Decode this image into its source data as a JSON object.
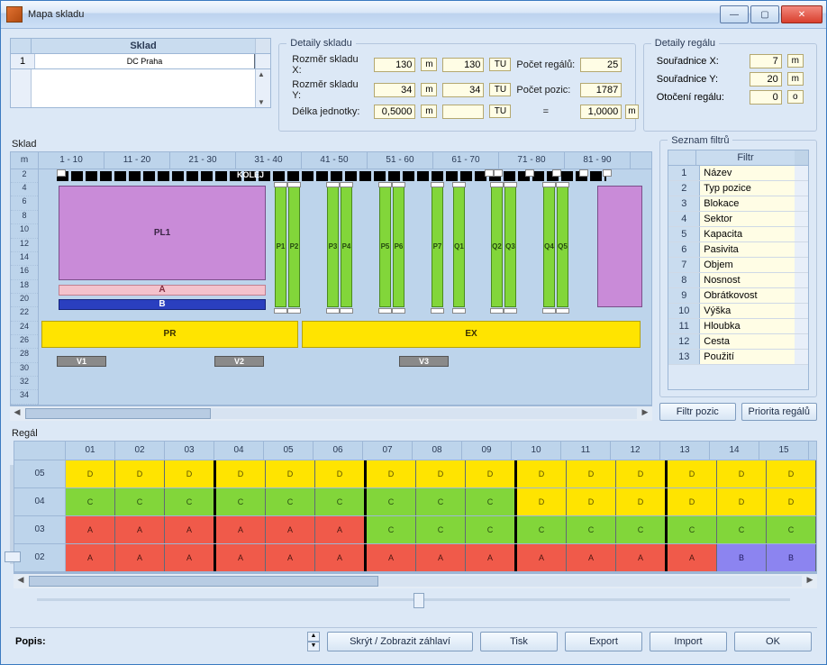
{
  "window": {
    "title": "Mapa skladu"
  },
  "sklad_picker": {
    "header": "Sklad",
    "rows": [
      {
        "num": "1",
        "name": "DC Praha"
      }
    ]
  },
  "details_sklad": {
    "legend": "Detaily skladu",
    "rows": [
      {
        "label": "Rozměr skladu X:",
        "v1": "130",
        "u1": "m",
        "v2": "130",
        "u2": "TU",
        "label2": "Počet regálů:",
        "v3": "25"
      },
      {
        "label": "Rozměr skladu Y:",
        "v1": "34",
        "u1": "m",
        "v2": "34",
        "u2": "TU",
        "label2": "Počet pozic:",
        "v3": "1787"
      },
      {
        "label": "Délka jednotky:",
        "v1": "0,5000",
        "u1": "m",
        "v2": "",
        "u2": "TU",
        "label2": "=",
        "v3": "1,0000",
        "u3": "m"
      }
    ]
  },
  "details_regal": {
    "legend": "Detaily regálu",
    "rows": [
      {
        "label": "Souřadnice X:",
        "v": "7",
        "u": "m"
      },
      {
        "label": "Souřadnice Y:",
        "v": "20",
        "u": "m"
      },
      {
        "label": "Otočení regálu:",
        "v": "0",
        "u": "o"
      }
    ]
  },
  "map": {
    "label": "Sklad",
    "cols": [
      "m",
      "1 - 10",
      "11 - 20",
      "21 - 30",
      "31 - 40",
      "41 - 50",
      "51 - 60",
      "61 - 70",
      "71 - 80",
      "81 - 90"
    ],
    "rows": [
      "2",
      "4",
      "6",
      "8",
      "10",
      "12",
      "14",
      "16",
      "18",
      "20",
      "22",
      "24",
      "26",
      "28",
      "30",
      "32",
      "34"
    ],
    "kolej": "KOLEJ",
    "pl": "PL1",
    "a": "A",
    "b": "B",
    "pr": "PR",
    "ex": "EX",
    "racks": [
      "P1",
      "P2",
      "P3",
      "P4",
      "P5",
      "P6",
      "P7",
      "Q1",
      "Q2",
      "Q3",
      "Q4",
      "Q5"
    ],
    "v": [
      "V1",
      "V2",
      "V3"
    ]
  },
  "filters": {
    "legend": "Seznam filtrů",
    "header": "Filtr",
    "items": [
      {
        "n": "1",
        "t": "Název"
      },
      {
        "n": "2",
        "t": "Typ pozice"
      },
      {
        "n": "3",
        "t": "Blokace"
      },
      {
        "n": "4",
        "t": "Sektor"
      },
      {
        "n": "5",
        "t": "Kapacita"
      },
      {
        "n": "6",
        "t": "Pasivita"
      },
      {
        "n": "7",
        "t": "Objem"
      },
      {
        "n": "8",
        "t": "Nosnost"
      },
      {
        "n": "9",
        "t": "Obrátkovost"
      },
      {
        "n": "10",
        "t": "Výška"
      },
      {
        "n": "11",
        "t": "Hloubka"
      },
      {
        "n": "12",
        "t": "Cesta"
      },
      {
        "n": "13",
        "t": "Použití"
      }
    ],
    "btn1": "Filtr pozic",
    "btn2": "Priorita regálů"
  },
  "regal": {
    "label": "Regál",
    "cols": [
      "01",
      "02",
      "03",
      "04",
      "05",
      "06",
      "07",
      "08",
      "09",
      "10",
      "11",
      "12",
      "13",
      "14",
      "15"
    ],
    "rows": [
      "05",
      "04",
      "03",
      "02"
    ],
    "cells": [
      [
        "D",
        "D",
        "D",
        "D",
        "D",
        "D",
        "D",
        "D",
        "D",
        "D",
        "D",
        "D",
        "D",
        "D",
        "D"
      ],
      [
        "C",
        "C",
        "C",
        "C",
        "C",
        "C",
        "C",
        "C",
        "C",
        "D",
        "D",
        "D",
        "D",
        "D",
        "D"
      ],
      [
        "A",
        "A",
        "A",
        "A",
        "A",
        "A",
        "C",
        "C",
        "C",
        "C",
        "C",
        "C",
        "C",
        "C",
        "C"
      ],
      [
        "A",
        "A",
        "A",
        "A",
        "A",
        "A",
        "A",
        "A",
        "A",
        "A",
        "A",
        "A",
        "A",
        "B",
        "B"
      ]
    ],
    "colors": [
      [
        "y",
        "y",
        "y",
        "y",
        "y",
        "y",
        "y",
        "y",
        "y",
        "y",
        "y",
        "y",
        "y",
        "y",
        "y"
      ],
      [
        "g",
        "g",
        "g",
        "g",
        "g",
        "g",
        "g",
        "g",
        "g",
        "y",
        "y",
        "y",
        "y",
        "y",
        "y"
      ],
      [
        "r",
        "r",
        "r",
        "r",
        "r",
        "r",
        "g",
        "g",
        "g",
        "g",
        "g",
        "g",
        "g",
        "g",
        "g"
      ],
      [
        "r",
        "r",
        "r",
        "r",
        "r",
        "r",
        "r",
        "r",
        "r",
        "r",
        "r",
        "r",
        "r",
        "b",
        "b"
      ]
    ],
    "thickAfter": [
      3,
      6,
      9,
      12
    ]
  },
  "footer": {
    "popis": "Popis:",
    "btns": [
      "Skrýt / Zobrazit záhlaví",
      "Tisk",
      "Export",
      "Import",
      "OK"
    ]
  }
}
